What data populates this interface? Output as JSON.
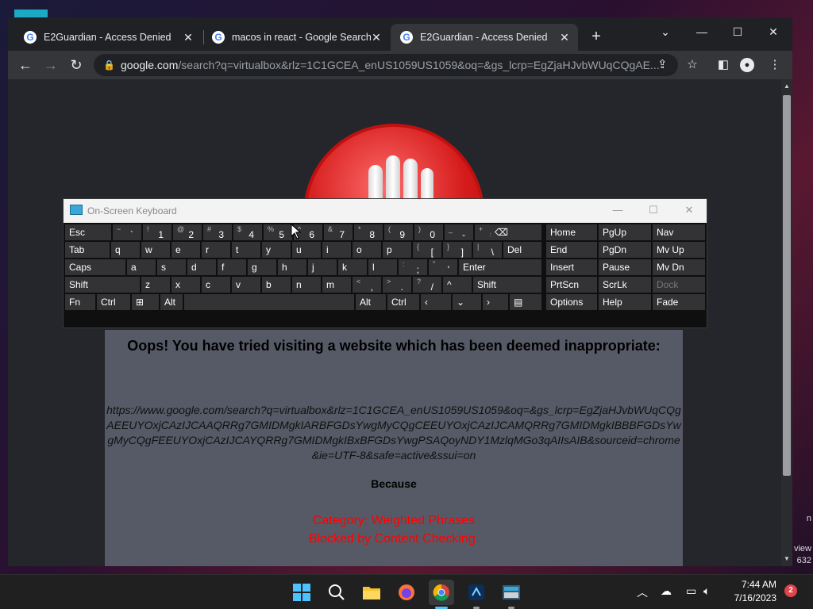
{
  "browser": {
    "tabs": [
      {
        "title": "E2Guardian - Access Denied",
        "active": false
      },
      {
        "title": "macos in react - Google Search",
        "active": false
      },
      {
        "title": "E2Guardian - Access Denied",
        "active": true
      }
    ],
    "tab_close_glyph": "✕",
    "new_tab_glyph": "+",
    "window_controls": {
      "dropdown": "⌄",
      "minimize": "—",
      "maximize": "☐",
      "close": "✕"
    },
    "url_host": "google.com",
    "url_path": "/search?q=virtualbox&rlz=1C1GCEA_enUS1059US1059&oq=&gs_lcrp=EgZjaHJvbWUqCQgAE..."
  },
  "page": {
    "heading": "Oops! You have tried visiting a website which has been deemed inappropriate:",
    "blocked_url": "https://www.google.com/search?q=virtualbox&rlz=1C1GCEA_enUS1059US1059&oq=&gs_lcrp=EgZjaHJvbWUqCQgAEEUYOxjCAzIJCAAQRRg7GMIDMgkIARBFGDsYwgMyCQgCEEUYOxjCAzIJCAMQRRg7GMIDMgkIBBBFGDsYwgMyCQgFEEUYOxjCAzIJCAYQRRg7GMIDMgkIBxBFGDsYwgPSAQoyNDY1MzlqMGo3qAIIsAIB&sourceid=chrome&ie=UTF-8&safe=active&ssui=on",
    "because": "Because",
    "category": "Category: Weighted Phrases",
    "reason": "Blocked by Content Checking."
  },
  "osk": {
    "title": "On-Screen Keyboard",
    "controls": {
      "minimize": "—",
      "maximize": "☐",
      "close": "✕"
    },
    "row1": [
      {
        "label": "Esc"
      },
      {
        "sub": "~",
        "main": "`"
      },
      {
        "sub": "!",
        "main": "1"
      },
      {
        "sub": "@",
        "main": "2"
      },
      {
        "sub": "#",
        "main": "3"
      },
      {
        "sub": "$",
        "main": "4"
      },
      {
        "sub": "%",
        "main": "5"
      },
      {
        "sub": "^",
        "main": "6"
      },
      {
        "sub": "&",
        "main": "7"
      },
      {
        "sub": "*",
        "main": "8"
      },
      {
        "sub": "(",
        "main": "9"
      },
      {
        "sub": ")",
        "main": "0"
      },
      {
        "sub": "_",
        "main": "-"
      },
      {
        "sub": "+",
        "main": "="
      },
      {
        "label": "⌫"
      }
    ],
    "row2": [
      {
        "label": "Tab"
      },
      {
        "label": "q"
      },
      {
        "label": "w"
      },
      {
        "label": "e"
      },
      {
        "label": "r"
      },
      {
        "label": "t"
      },
      {
        "label": "y"
      },
      {
        "label": "u"
      },
      {
        "label": "i"
      },
      {
        "label": "o"
      },
      {
        "label": "p"
      },
      {
        "sub": "{",
        "main": "["
      },
      {
        "sub": "}",
        "main": "]"
      },
      {
        "sub": "|",
        "main": "\\"
      },
      {
        "label": "Del"
      }
    ],
    "row3": [
      {
        "label": "Caps"
      },
      {
        "label": "a"
      },
      {
        "label": "s"
      },
      {
        "label": "d"
      },
      {
        "label": "f"
      },
      {
        "label": "g"
      },
      {
        "label": "h"
      },
      {
        "label": "j"
      },
      {
        "label": "k"
      },
      {
        "label": "l"
      },
      {
        "sub": ":",
        "main": ";"
      },
      {
        "sub": "\"",
        "main": "'"
      },
      {
        "label": "Enter"
      }
    ],
    "row4": [
      {
        "label": "Shift"
      },
      {
        "label": "z"
      },
      {
        "label": "x"
      },
      {
        "label": "c"
      },
      {
        "label": "v"
      },
      {
        "label": "b"
      },
      {
        "label": "n"
      },
      {
        "label": "m"
      },
      {
        "sub": "<",
        "main": ","
      },
      {
        "sub": ">",
        "main": "."
      },
      {
        "sub": "?",
        "main": "/"
      },
      {
        "label": "^"
      },
      {
        "label": "Shift"
      }
    ],
    "row5": [
      {
        "label": "Fn"
      },
      {
        "label": "Ctrl"
      },
      {
        "label": "⊞"
      },
      {
        "label": "Alt"
      },
      {
        "label": ""
      },
      {
        "label": "Alt"
      },
      {
        "label": "Ctrl"
      },
      {
        "label": "‹"
      },
      {
        "label": "⌄"
      },
      {
        "label": "›"
      },
      {
        "label": "▤"
      }
    ],
    "nav_keys": [
      [
        "Home",
        "PgUp",
        "Nav"
      ],
      [
        "End",
        "PgDn",
        "Mv Up"
      ],
      [
        "Insert",
        "Pause",
        "Mv Dn"
      ],
      [
        "PrtScn",
        "ScrLk",
        "Dock"
      ],
      [
        "Options",
        "Help",
        "Fade"
      ]
    ]
  },
  "taskbar": {
    "apps": [
      "start",
      "search",
      "file-explorer",
      "firefox",
      "chrome",
      "app",
      "on-screen-keyboard"
    ],
    "time": "7:44 AM",
    "date": "7/16/2023",
    "notification_count": "2"
  },
  "desktop": {
    "edge_text": [
      "n",
      "view",
      "632"
    ]
  }
}
